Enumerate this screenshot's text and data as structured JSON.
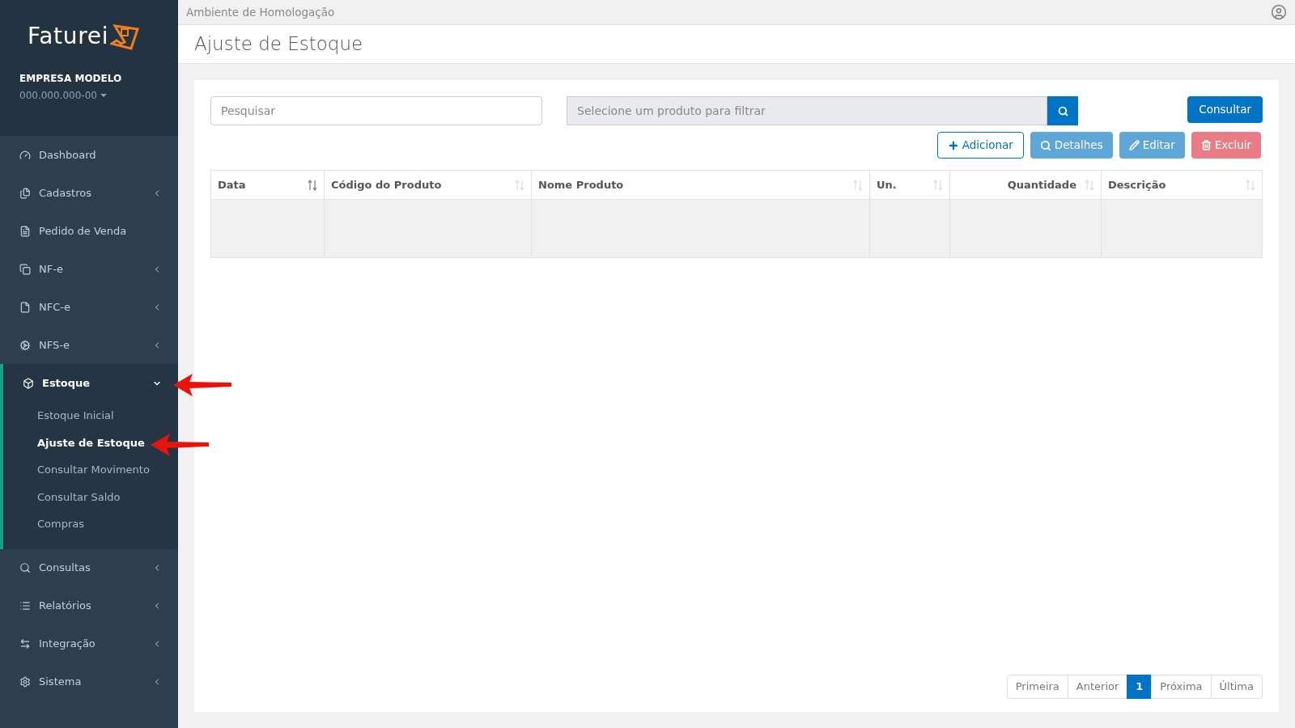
{
  "sidebar": {
    "logo": "Faturei",
    "company": "EMPRESA MODELO",
    "document": "000.000.000-00",
    "items": [
      {
        "label": "Dashboard"
      },
      {
        "label": "Cadastros",
        "expanded": false
      },
      {
        "label": "Pedido de Venda"
      },
      {
        "label": "NF-e",
        "expanded": false
      },
      {
        "label": "NFC-e",
        "expanded": false
      },
      {
        "label": "NFS-e",
        "expanded": false
      },
      {
        "label": "Estoque",
        "expanded": true,
        "children": [
          {
            "label": "Estoque Inicial",
            "selected": false
          },
          {
            "label": "Ajuste de Estoque",
            "selected": true
          },
          {
            "label": "Consultar Movimento",
            "selected": false
          },
          {
            "label": "Consultar Saldo",
            "selected": false
          },
          {
            "label": "Compras",
            "selected": false
          }
        ]
      },
      {
        "label": "Consultas",
        "expanded": false
      },
      {
        "label": "Relatórios",
        "expanded": false
      },
      {
        "label": "Integração",
        "expanded": false
      },
      {
        "label": "Sistema",
        "expanded": false
      }
    ]
  },
  "topbar": {
    "environment": "Ambiente de Homologação"
  },
  "page": {
    "title": "Ajuste de Estoque"
  },
  "filters": {
    "search": {
      "placeholder": "Pesquisar"
    },
    "product": {
      "placeholder": "Selecione um produto para filtrar"
    },
    "submit": "Consultar"
  },
  "actions": [
    {
      "label": "Adicionar",
      "kind": "add"
    },
    {
      "label": "Detalhes",
      "kind": "details"
    },
    {
      "label": "Editar",
      "kind": "edit"
    },
    {
      "label": "Excluir",
      "kind": "delete"
    }
  ],
  "table": {
    "columns": [
      {
        "label": "Data",
        "sorted": true,
        "kind": "text"
      },
      {
        "label": "Código do Produto",
        "sorted": false,
        "kind": "text"
      },
      {
        "label": "Nome Produto",
        "sorted": false,
        "kind": "text"
      },
      {
        "label": "Un.",
        "sorted": false,
        "kind": "text"
      },
      {
        "label": "Quantidade",
        "sorted": false,
        "kind": "number"
      },
      {
        "label": "Descrição",
        "sorted": false,
        "kind": "text"
      }
    ]
  },
  "pagination": [
    {
      "label": "Primeira",
      "selected": false
    },
    {
      "label": "Anterior",
      "selected": false
    },
    {
      "label": "1",
      "selected": true
    },
    {
      "label": "Próxima",
      "selected": false
    },
    {
      "label": "Última",
      "selected": false
    }
  ]
}
